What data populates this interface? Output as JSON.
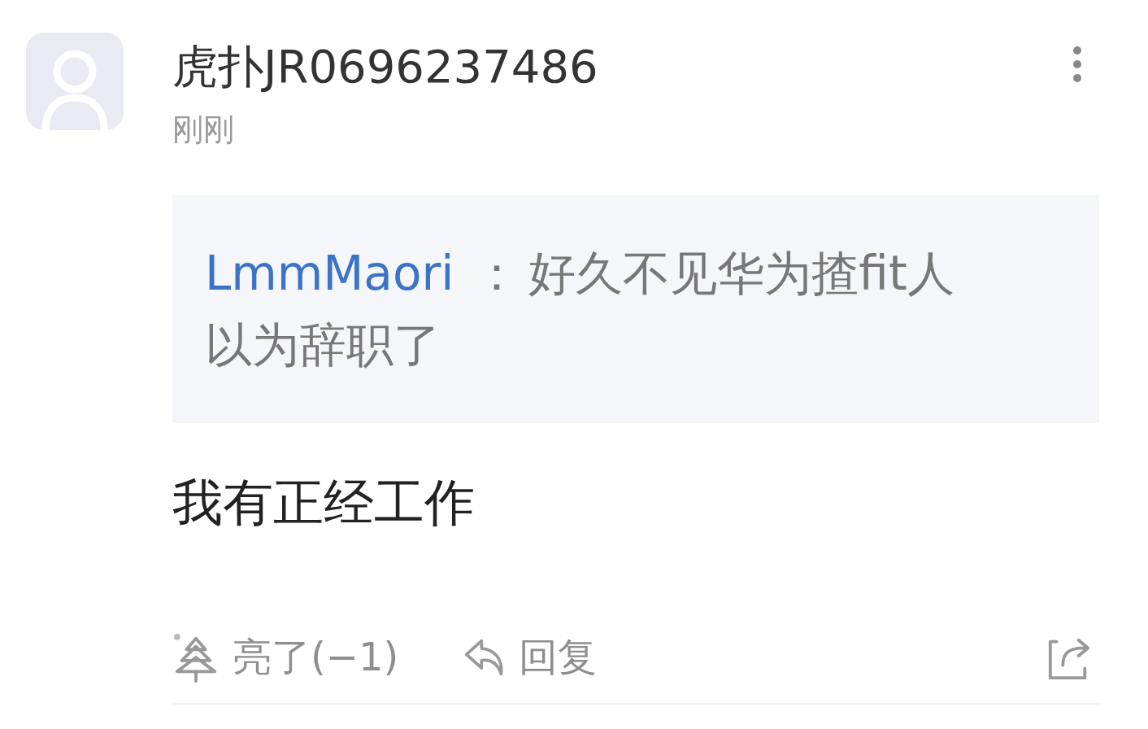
{
  "comment": {
    "username": "虎扑JR0696237486",
    "time": "刚刚",
    "quote": {
      "author": "LmmMaori",
      "separator": "：",
      "text": "好久不见华为揸fit人以为辞职了"
    },
    "body": "我有正经工作",
    "actions": {
      "light": "亮了(−1)",
      "reply": "回复"
    }
  }
}
